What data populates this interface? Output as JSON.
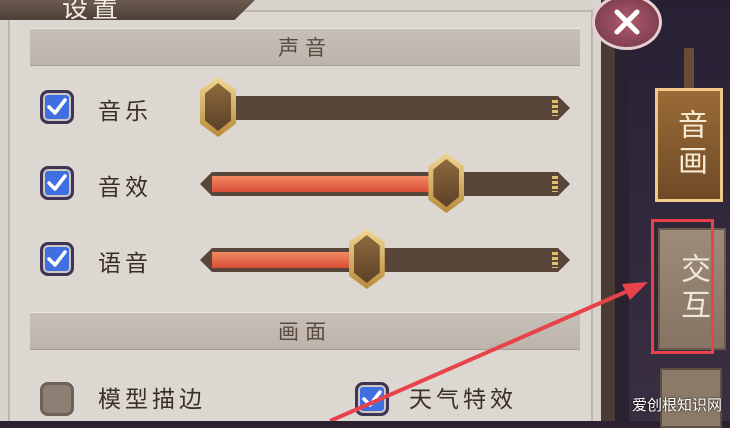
{
  "header": {
    "title": "设置"
  },
  "sections": {
    "sound": "声音",
    "graphics": "画面"
  },
  "sliders": [
    {
      "label": "音乐",
      "enabled": true,
      "level": 0.0
    },
    {
      "label": "音效",
      "enabled": true,
      "level": 0.66
    },
    {
      "label": "语音",
      "enabled": true,
      "level": 0.43
    }
  ],
  "graphics_options": [
    {
      "label": "模型描边",
      "checked": false
    },
    {
      "label": "天气特效",
      "checked": true
    }
  ],
  "side_tabs": [
    {
      "label": "音画",
      "active": true
    },
    {
      "label": "交互",
      "active": false
    }
  ],
  "watermark": "爱创根知识网",
  "colors": {
    "checkbox": "#3f6fe0",
    "slider_fill": "#e8623f",
    "highlight": "#e8434b"
  }
}
